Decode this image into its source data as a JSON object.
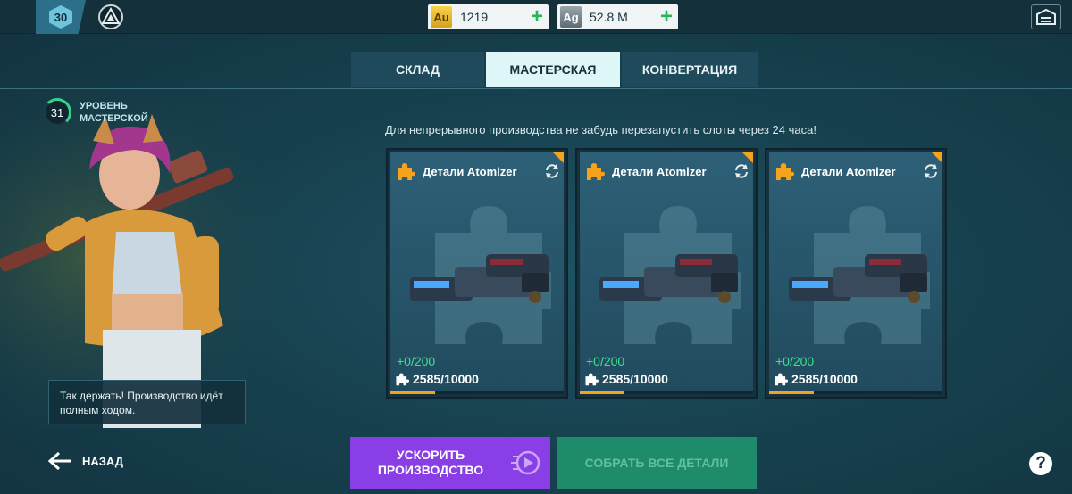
{
  "topbar": {
    "player_level": "30",
    "gold": {
      "code": "Au",
      "value": "1219"
    },
    "silver": {
      "code": "Ag",
      "value": "52.8 M"
    },
    "plus_symbol": "+"
  },
  "tabs": [
    {
      "label": "СКЛАД",
      "active": false
    },
    {
      "label": "МАСТЕРСКАЯ",
      "active": true
    },
    {
      "label": "КОНВЕРТАЦИЯ",
      "active": false
    }
  ],
  "workshop": {
    "level_value": "31",
    "level_label": "УРОВЕНЬ МАСТЕРСКОЙ"
  },
  "speech": "Так держать! Производство идёт полным ходом.",
  "hint": "Для непрерывного производства не забудь перезапустить слоты через 24 часа!",
  "cards": [
    {
      "title": "Детали Atomizer",
      "gain": "+0/200",
      "progress": "2585/10000",
      "progress_fraction": 0.2585
    },
    {
      "title": "Детали Atomizer",
      "gain": "+0/200",
      "progress": "2585/10000",
      "progress_fraction": 0.2585
    },
    {
      "title": "Детали Atomizer",
      "gain": "+0/200",
      "progress": "2585/10000",
      "progress_fraction": 0.2585
    }
  ],
  "bottom": {
    "back_label": "НАЗАД",
    "speedup_label": "УСКОРИТЬ ПРОИЗВОДСТВО",
    "collect_label": "СОБРАТЬ ВСЕ ДЕТАЛИ",
    "help_symbol": "?"
  },
  "colors": {
    "accent_orange": "#f5a21c",
    "speedup_purple": "#8a3ee6",
    "collect_green": "#1e8b6b",
    "gain_green": "#3ce38d"
  }
}
